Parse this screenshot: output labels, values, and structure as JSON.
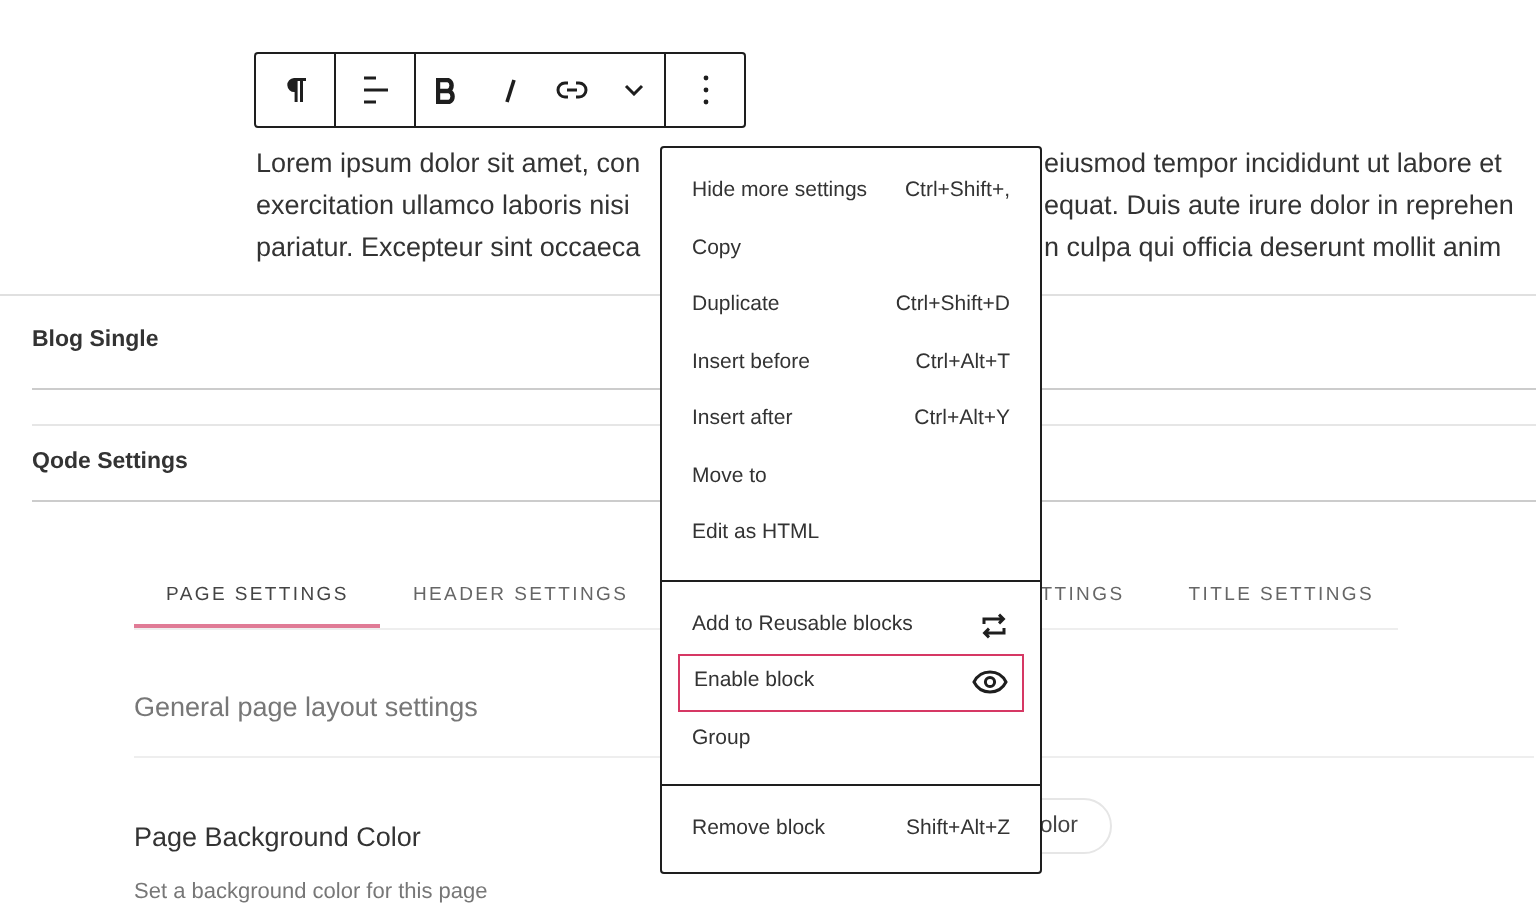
{
  "toolbar": {
    "buttons": [
      {
        "kind": "paragraph"
      },
      {
        "kind": "align"
      },
      {
        "kind": "bold"
      },
      {
        "kind": "italic"
      },
      {
        "kind": "link"
      },
      {
        "kind": "more"
      },
      {
        "kind": "options"
      }
    ]
  },
  "paragraph": {
    "lines": [
      {
        "left": "Lorem ipsum dolor sit amet, con",
        "right": "eiusmod tempor incididunt ut labore et"
      },
      {
        "left": "exercitation ullamco laboris nisi",
        "right": "equat. Duis aute irure dolor in reprehen"
      },
      {
        "left": "pariatur. Excepteur sint occaeca",
        "right": "n culpa qui officia deserunt mollit anim"
      }
    ]
  },
  "panels": [
    {
      "title": "Blog Single"
    },
    {
      "title": "Qode Settings"
    }
  ],
  "tabs": [
    {
      "label": "PAGE SETTINGS",
      "selected": true
    },
    {
      "label": "HEADER SETTINGS",
      "selected": false
    },
    {
      "label": "TTINGS",
      "selected": false
    },
    {
      "label": "TITLE SETTINGS",
      "selected": false
    }
  ],
  "section_title": "General page layout settings",
  "field": {
    "label": "Page Background Color",
    "description": "Set a background color for this page",
    "button": "olor"
  },
  "menu": {
    "groups": [
      [
        {
          "label": "Hide more settings",
          "shortcut": "Ctrl+Shift+,",
          "highlighted": false
        },
        {
          "label": "Copy",
          "highlighted": false
        },
        {
          "label": "Duplicate",
          "shortcut": "Ctrl+Shift+D",
          "highlighted": false
        },
        {
          "label": "Insert before",
          "shortcut": "Ctrl+Alt+T",
          "highlighted": false
        },
        {
          "label": "Insert after",
          "shortcut": "Ctrl+Alt+Y",
          "highlighted": false
        },
        {
          "label": "Move to",
          "highlighted": false
        },
        {
          "label": "Edit as HTML",
          "highlighted": false
        }
      ],
      [
        {
          "label": "Add to Reusable blocks",
          "kind": "reuse",
          "highlighted": false
        },
        {
          "label": "Enable block",
          "kind": "eye",
          "highlighted": true
        },
        {
          "label": "Group",
          "highlighted": false
        }
      ],
      [
        {
          "label": "Remove block",
          "shortcut": "Shift+Alt+Z",
          "highlighted": false
        }
      ]
    ]
  }
}
